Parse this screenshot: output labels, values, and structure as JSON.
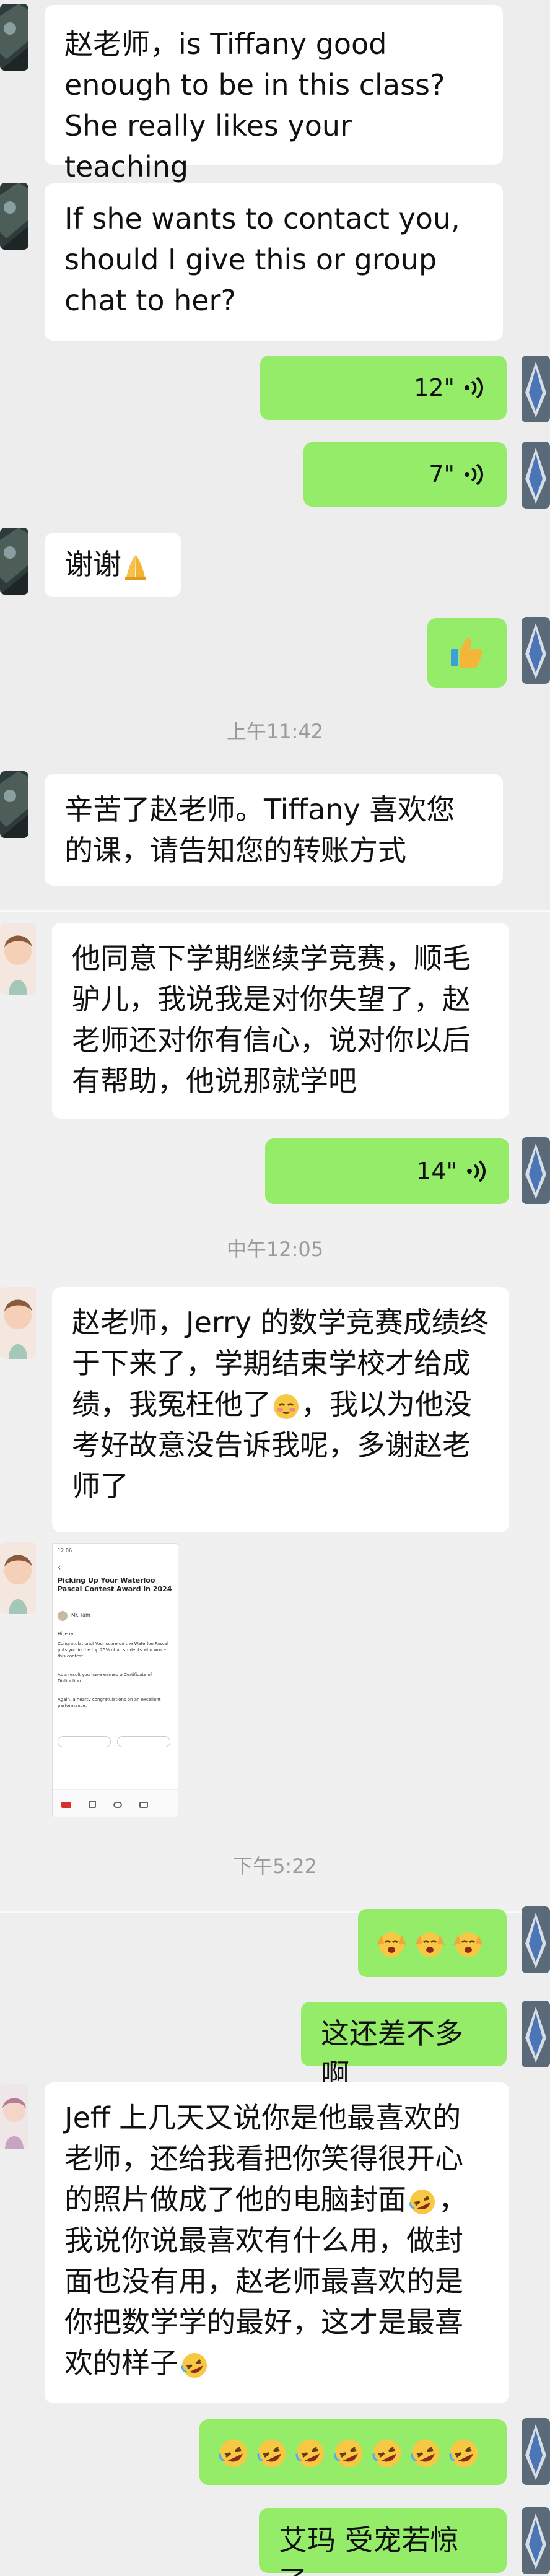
{
  "messages": {
    "m1_text": "赵老师，is Tiffany good enough to be in this class? She really likes your teaching",
    "m2_text": "If she wants to contact you, should I give this or group chat to her?",
    "m3_duration": "12\"",
    "m4_duration": "7\"",
    "m5_text": "谢谢",
    "ts1": "上午11:42",
    "m7_text": "辛苦了赵老师。Tiffany 喜欢您的课，请告知您的转账方式",
    "m8_text": "他同意下学期继续学竞赛，顺毛驴儿，我说我是对你失望了，赵老师还对你有信心，说对你以后有帮助，他说那就学吧",
    "m9_duration": "14\"",
    "ts2": "中午12:05",
    "m10_text_a": "赵老师，Jerry 的数学竞赛成绩终于下来了，学期结束学校才给成绩，我冤枉他了",
    "m10_text_b": "，我以为他没考好故意没告诉我呢，多谢赵老师了",
    "ts3": "下午5:22",
    "m12_text": "这还差不多啊",
    "m13_text_a": "Jeff 上几天又说你是他最喜欢的老师，还给我看把你笑得很开心的照片做成了他的电脑封面",
    "m13_text_b": "，我说你说最喜欢有什么用，做封面也没有用，赵老师最喜欢的是你把数学学的最好，这才是最喜欢的样子",
    "m15_text": "艾玛 受宠若惊了"
  },
  "screenshot_card": {
    "status_time": "12:06",
    "heading": "Picking Up Your Waterloo Pascal Contest Award in 2024",
    "sender": "Mr. Tam",
    "body_1": "Hi Jerry,",
    "body_2": "Congratulations! Your score on the Waterloo Pascal puts you in the top 25% of all students who wrote this contest.",
    "body_3": "As a result you have earned a Certificate of Distinction.",
    "body_4": "Again, a hearty congratulations on an excellent performance."
  },
  "icons": {
    "voice": "voice-wave-icon",
    "praying": "praying-hands-emoji",
    "thumbs": "thumbs-up-emoji",
    "cheer": "cheering-face-emoji",
    "blush": "blushing-face-emoji",
    "laugh": "rolling-laugh-emoji"
  },
  "colors": {
    "incoming_bubble": "#ffffff",
    "outgoing_bubble": "#95ec69",
    "background": "#ededed",
    "timestamp": "#9b9b9b"
  }
}
